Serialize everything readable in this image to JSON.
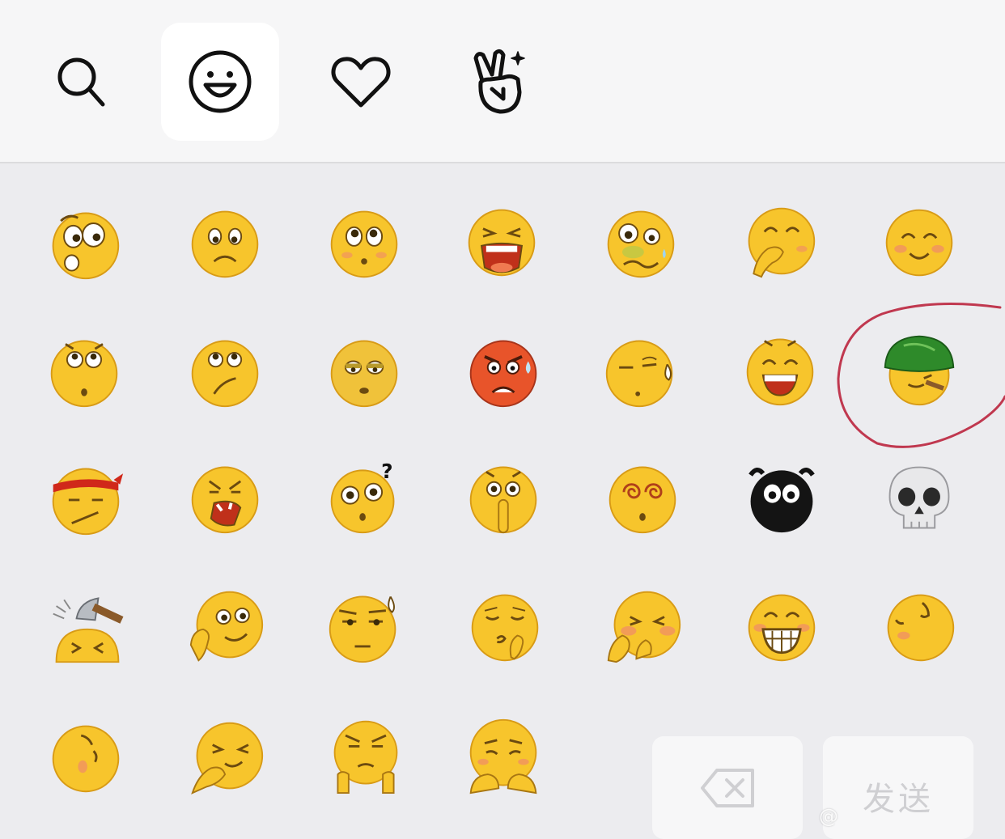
{
  "tabs": [
    {
      "icon": "search-icon",
      "active": false
    },
    {
      "icon": "smiley-icon",
      "active": true
    },
    {
      "icon": "heart-icon",
      "active": false
    },
    {
      "icon": "victory-hand-sparkle-icon",
      "active": false
    }
  ],
  "emoji_grid": {
    "columns": 7,
    "rows": [
      [
        "surprised",
        "sad",
        "pitiful",
        "screaming",
        "drunk",
        "covering-mouth-laugh",
        "blushing-smile"
      ],
      [
        "rolling-eyes",
        "unhappy",
        "sleepy",
        "angry-red-sweat",
        "awkward-sweat",
        "grinning",
        "green-hat-smoking"
      ],
      [
        "headband-determined",
        "fierce-shout",
        "question-confused",
        "shush",
        "dizzy-eyes",
        "black-ghost",
        "skull"
      ],
      [
        "hammer-hit",
        "thinking-smirk",
        "speechless-sweat",
        "kiss",
        "shy-hands",
        "big-grin",
        "tilted-shy"
      ],
      [
        "lying-shy",
        "sneaky-laugh",
        "frowning-hands",
        "pleading"
      ]
    ],
    "highlighted": "green-hat-smoking"
  },
  "colors": {
    "panel_bg": "#ececef",
    "tabbar_bg": "#f6f6f7",
    "emoji_yellow": "#f7c52c",
    "highlight_circle": "#c0384f"
  },
  "actions": {
    "delete_icon": "backspace-icon",
    "send_label": "发送"
  },
  "watermark": "@"
}
